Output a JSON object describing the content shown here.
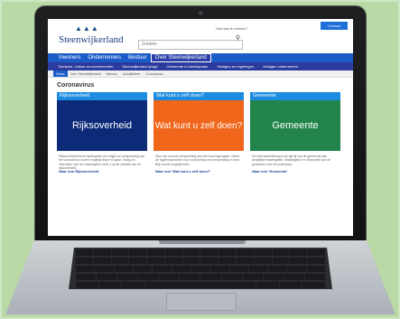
{
  "header": {
    "logo_text": "Steenwijkerland",
    "search_placeholder": "Zoeken",
    "search_help": "Hoe kan ik zoeken?",
    "top_button": "Contact"
  },
  "main_nav": [
    "Inwoners",
    "Ondernemers",
    "Bestuur",
    "Over Steenwijkerland"
  ],
  "sub_nav": [
    "Toerisme, cultuur en evenementen",
    "Steenwijkerland jeugd",
    "Gemeente in beeldspraak",
    "Vestigen en regelingen",
    "Vestigen ondernemen"
  ],
  "breadcrumbs": [
    "Home",
    "Over Steenwijkerland",
    "Nieuws",
    "Actualiteiten",
    "Coronavirus"
  ],
  "page_title": "Coronavirus",
  "cards": [
    {
      "head": "Rijksoverheid",
      "tile": "Rijksoverheid",
      "text": "Rijksoverheid biedt maatregelen (en krijgt) om verspreiding van het coronavirus zoveel mogelijk tegen te gaan. Vraag en informatie over de maatregelen vindt u op de website van de rijksoverheid.",
      "link": "Naar ons Rijksoverheid"
    },
    {
      "head": "Wat kunt u zelf doen?",
      "tile": "Wat kunt u zelf doen?",
      "text": "Elke van ons kan verspreiding van het virus tegengaan. Neem de hygiëneadviezen voor voorkoming van verspreiding in acht. Blijf zoveel mogelijk thuis.",
      "link": "Naar ons 'Wat kunt u zelf doen?'"
    },
    {
      "head": "Gemeente",
      "tile": "Gemeente",
      "text": "De hele samenleving is de pijl bij hoe de gemeente aan dergelijke maatregelen. Maatregelen en informatie van de gemeente over dit onderwerp.",
      "link": "Naar ons 'Gemeente'"
    }
  ],
  "colors": {
    "background": "#b9d9a6",
    "nav_blue": "#1a5cc8",
    "tile_rijk": "#0d2a78",
    "tile_zelf": "#f0661a",
    "tile_gemeente": "#22844a"
  }
}
